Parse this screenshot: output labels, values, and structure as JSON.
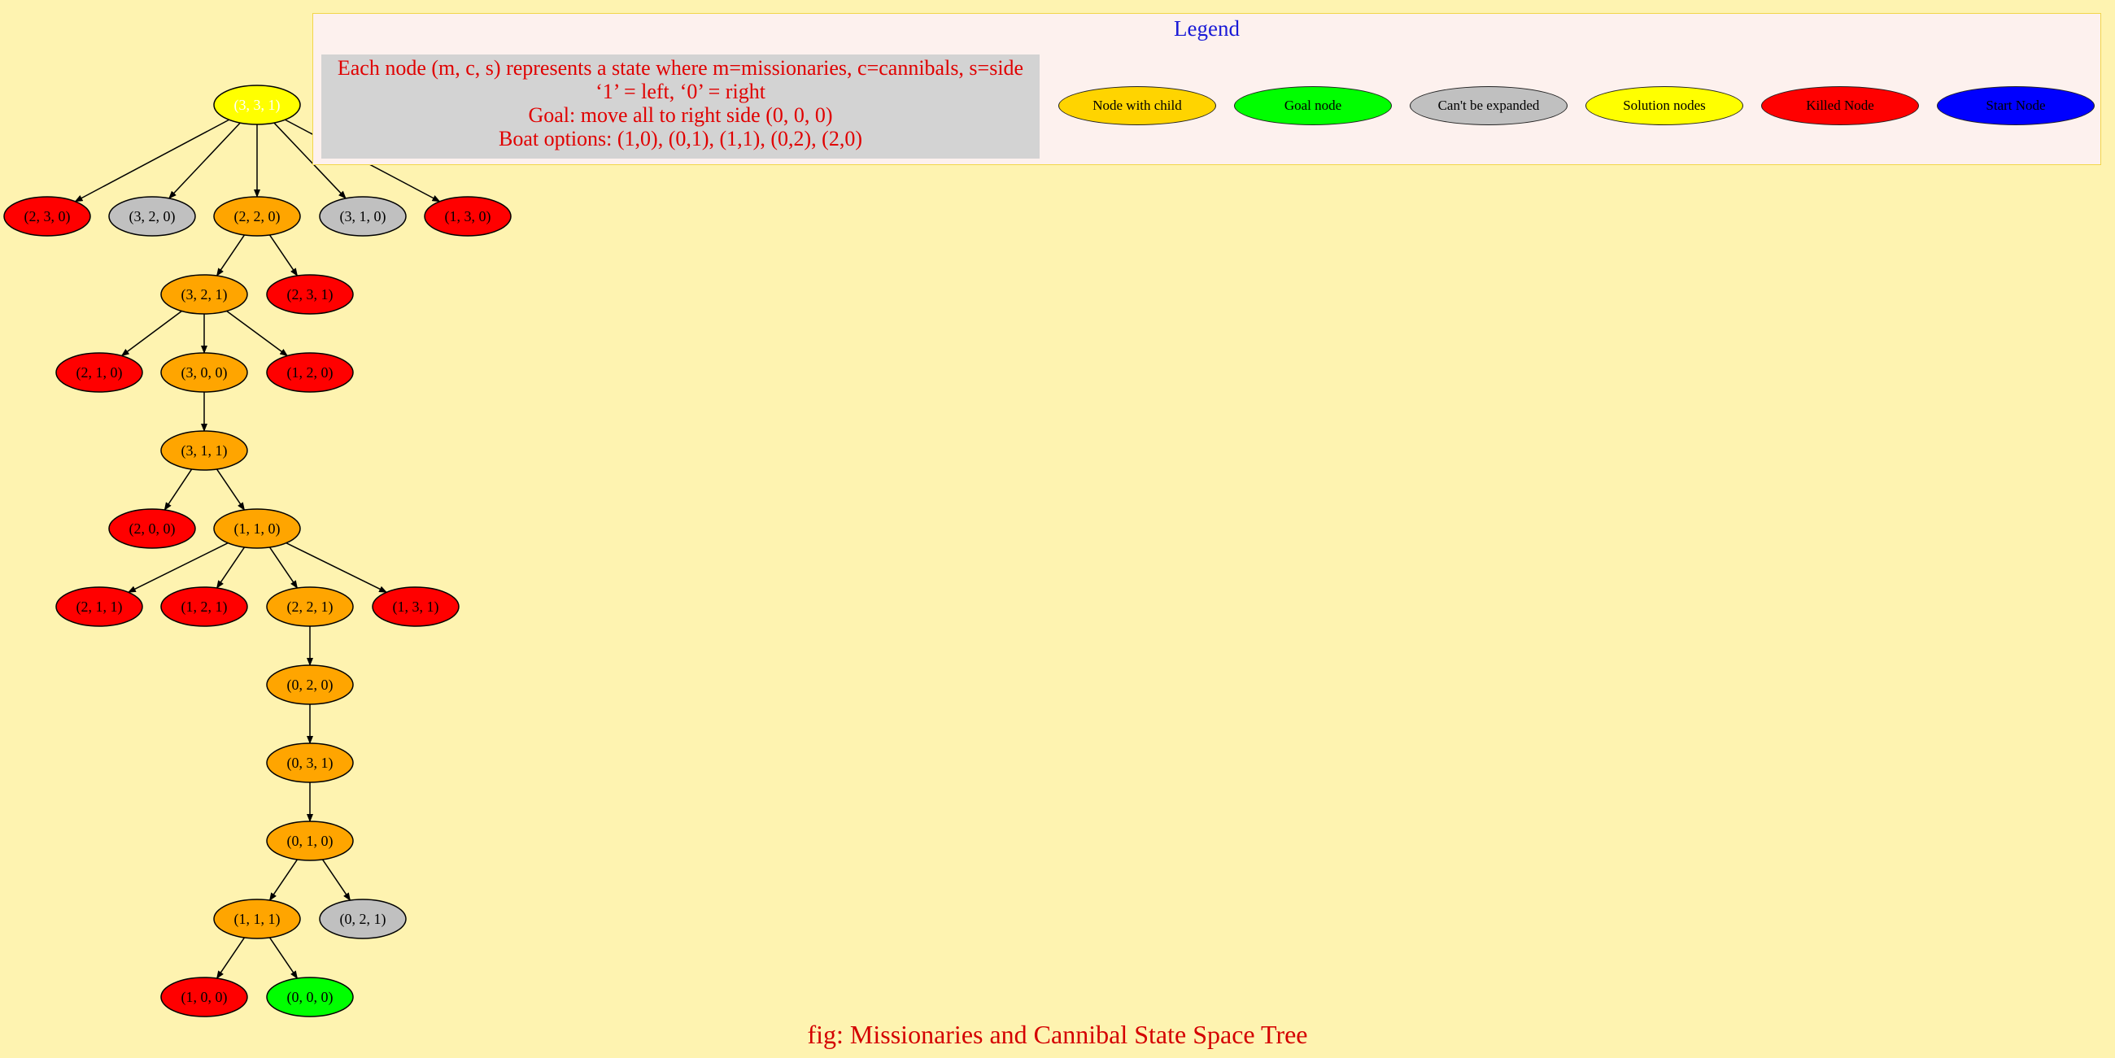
{
  "legend": {
    "title": "Legend",
    "description": [
      "Each node (m, c, s) represents a state where m=missionaries, c=cannibals, s=side",
      "‘1’ = left, ‘0’ = right",
      "Goal: move all to right side (0, 0, 0)",
      "Boat options: (1,0), (0,1), (1,1), (0,2), (2,0)"
    ],
    "items": [
      {
        "label": "Node with child",
        "color": "#ffd400"
      },
      {
        "label": "Goal node",
        "color": "#00ff00"
      },
      {
        "label": "Can't be expanded",
        "color": "#c0c0c0"
      },
      {
        "label": "Solution nodes",
        "color": "#ffff00"
      },
      {
        "label": "Killed Node",
        "color": "#ff0000"
      },
      {
        "label": "Start Node",
        "color": "#0000ff"
      }
    ]
  },
  "node_colors": {
    "start": "#ffff00",
    "expanded": "#ffa500",
    "killed": "#ff0000",
    "dead_end": "#c0c0c0",
    "goal": "#00ff00"
  },
  "tree": {
    "nodes": [
      {
        "id": "n0",
        "label": "(3, 3, 1)",
        "type": "start"
      },
      {
        "id": "n1",
        "label": "(2, 3, 0)",
        "type": "killed"
      },
      {
        "id": "n2",
        "label": "(3, 2, 0)",
        "type": "dead_end"
      },
      {
        "id": "n3",
        "label": "(2, 2, 0)",
        "type": "expanded"
      },
      {
        "id": "n4",
        "label": "(3, 1, 0)",
        "type": "dead_end"
      },
      {
        "id": "n5",
        "label": "(1, 3, 0)",
        "type": "killed"
      },
      {
        "id": "n6",
        "label": "(3, 2, 1)",
        "type": "expanded"
      },
      {
        "id": "n7",
        "label": "(2, 3, 1)",
        "type": "killed"
      },
      {
        "id": "n8",
        "label": "(2, 1, 0)",
        "type": "killed"
      },
      {
        "id": "n9",
        "label": "(3, 0, 0)",
        "type": "expanded"
      },
      {
        "id": "n10",
        "label": "(1, 2, 0)",
        "type": "killed"
      },
      {
        "id": "n11",
        "label": "(3, 1, 1)",
        "type": "expanded"
      },
      {
        "id": "n12",
        "label": "(2, 0, 0)",
        "type": "killed"
      },
      {
        "id": "n13",
        "label": "(1, 1, 0)",
        "type": "expanded"
      },
      {
        "id": "n14",
        "label": "(2, 1, 1)",
        "type": "killed"
      },
      {
        "id": "n15",
        "label": "(1, 2, 1)",
        "type": "killed"
      },
      {
        "id": "n16",
        "label": "(2, 2, 1)",
        "type": "expanded"
      },
      {
        "id": "n17",
        "label": "(1, 3, 1)",
        "type": "killed"
      },
      {
        "id": "n18",
        "label": "(0, 2, 0)",
        "type": "expanded"
      },
      {
        "id": "n19",
        "label": "(0, 3, 1)",
        "type": "expanded"
      },
      {
        "id": "n20",
        "label": "(0, 1, 0)",
        "type": "expanded"
      },
      {
        "id": "n21",
        "label": "(1, 1, 1)",
        "type": "expanded"
      },
      {
        "id": "n22",
        "label": "(0, 2, 1)",
        "type": "dead_end"
      },
      {
        "id": "n23",
        "label": "(1, 0, 0)",
        "type": "killed"
      },
      {
        "id": "n24",
        "label": "(0, 0, 0)",
        "type": "goal"
      }
    ],
    "edges": [
      [
        "n0",
        "n1"
      ],
      [
        "n0",
        "n2"
      ],
      [
        "n0",
        "n3"
      ],
      [
        "n0",
        "n4"
      ],
      [
        "n0",
        "n5"
      ],
      [
        "n3",
        "n6"
      ],
      [
        "n3",
        "n7"
      ],
      [
        "n6",
        "n8"
      ],
      [
        "n6",
        "n9"
      ],
      [
        "n6",
        "n10"
      ],
      [
        "n9",
        "n11"
      ],
      [
        "n11",
        "n12"
      ],
      [
        "n11",
        "n13"
      ],
      [
        "n13",
        "n14"
      ],
      [
        "n13",
        "n15"
      ],
      [
        "n13",
        "n16"
      ],
      [
        "n13",
        "n17"
      ],
      [
        "n16",
        "n18"
      ],
      [
        "n18",
        "n19"
      ],
      [
        "n19",
        "n20"
      ],
      [
        "n20",
        "n21"
      ],
      [
        "n20",
        "n22"
      ],
      [
        "n21",
        "n23"
      ],
      [
        "n21",
        "n24"
      ]
    ]
  },
  "caption": "fig: Missionaries and Cannibal State Space Tree"
}
